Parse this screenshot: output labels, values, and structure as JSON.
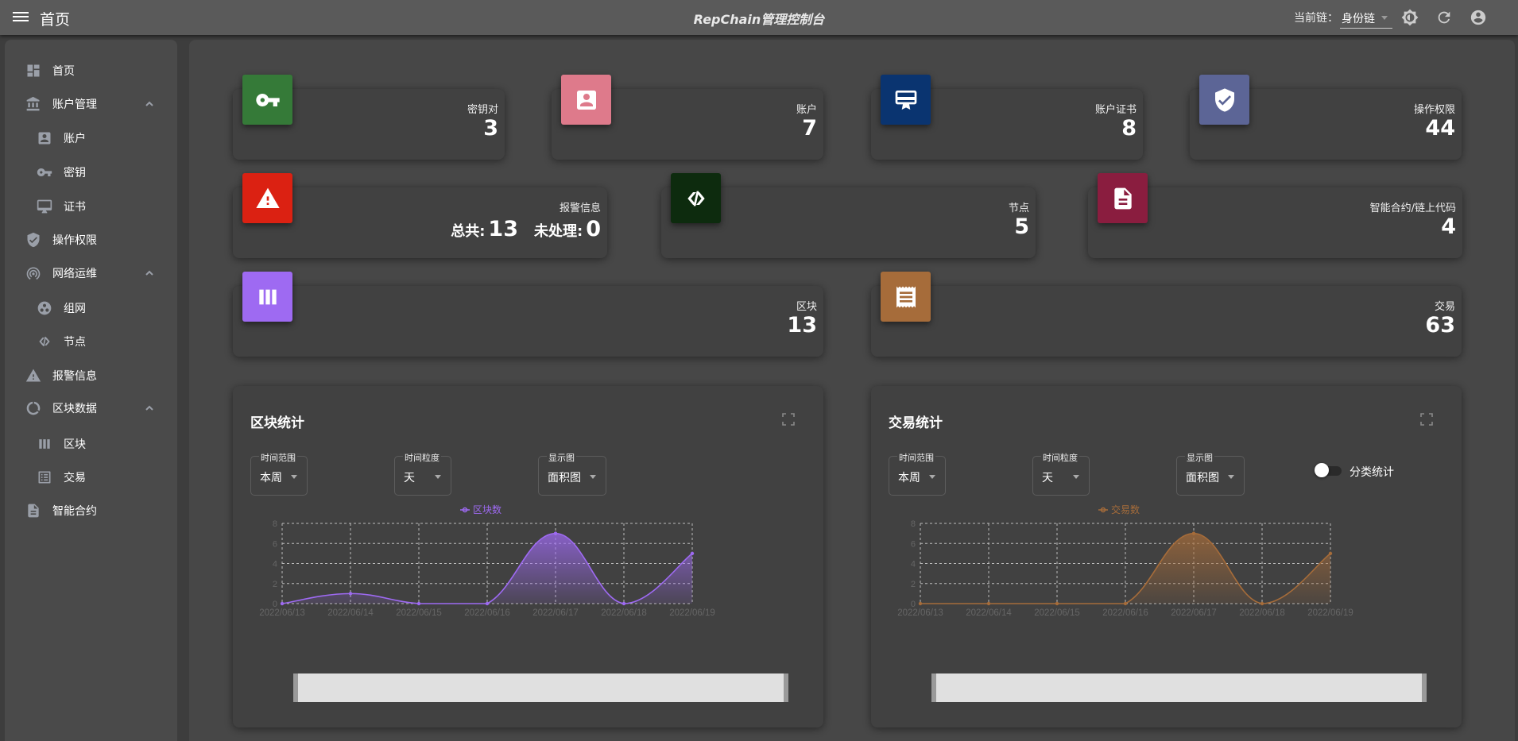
{
  "appbar": {
    "page_title": "首页",
    "app_title": "RepChain管理控制台",
    "chain_label": "当前链：",
    "chain_value": "身份链"
  },
  "sidebar": {
    "items": [
      {
        "label": "首页"
      },
      {
        "label": "账户管理"
      },
      {
        "label": "账户"
      },
      {
        "label": "密钥"
      },
      {
        "label": "证书"
      },
      {
        "label": "操作权限"
      },
      {
        "label": "网络运维"
      },
      {
        "label": "组网"
      },
      {
        "label": "节点"
      },
      {
        "label": "报警信息"
      },
      {
        "label": "区块数据"
      },
      {
        "label": "区块"
      },
      {
        "label": "交易"
      },
      {
        "label": "智能合约"
      }
    ]
  },
  "stats": {
    "keypair": {
      "label": "密钥对",
      "value": "3",
      "color": "#357a38"
    },
    "account": {
      "label": "账户",
      "value": "7",
      "color": "#de7a8b"
    },
    "cert": {
      "label": "账户证书",
      "value": "8",
      "color": "#0a3470"
    },
    "perm": {
      "label": "操作权限",
      "value": "44",
      "color": "#5c6596"
    },
    "alarm": {
      "label": "报警信息",
      "total_label": "总共:",
      "total": "13",
      "pending_label": "未处理:",
      "pending": "0",
      "color": "#db2112"
    },
    "node": {
      "label": "节点",
      "value": "5",
      "color": "#0d2b0e"
    },
    "contract": {
      "label": "智能合约/链上代码",
      "value": "4",
      "color": "#8a1d3f"
    },
    "block": {
      "label": "区块",
      "value": "13",
      "color": "#9e6af2"
    },
    "tx": {
      "label": "交易",
      "value": "63",
      "color": "#a66c3a"
    }
  },
  "block_chart": {
    "title": "区块统计",
    "range_label": "时间范围",
    "range_value": "本周",
    "gran_label": "时间粒度",
    "gran_value": "天",
    "view_label": "显示图",
    "view_value": "面积图"
  },
  "tx_chart": {
    "title": "交易统计",
    "range_label": "时间范围",
    "range_value": "本周",
    "gran_label": "时间粒度",
    "gran_value": "天",
    "view_label": "显示图",
    "view_value": "面积图",
    "toggle_label": "分类统计"
  },
  "chart_data": [
    {
      "type": "area",
      "x": [
        "2022/06/13",
        "2022/06/14",
        "2022/06/15",
        "2022/06/16",
        "2022/06/17",
        "2022/06/18",
        "2022/06/19"
      ],
      "series": [
        {
          "name": "区块数",
          "values": [
            0,
            1,
            0,
            0,
            7,
            0,
            5
          ],
          "color": "#9e6af2"
        }
      ],
      "ylim": [
        0,
        8
      ],
      "yticks": [
        0,
        2,
        4,
        6,
        8
      ],
      "legend": "top-center",
      "grid": true
    },
    {
      "type": "area",
      "x": [
        "2022/06/13",
        "2022/06/14",
        "2022/06/15",
        "2022/06/16",
        "2022/06/17",
        "2022/06/18",
        "2022/06/19"
      ],
      "series": [
        {
          "name": "交易数",
          "values": [
            0,
            0,
            0,
            0,
            7,
            0,
            5
          ],
          "color": "#a66c3a"
        }
      ],
      "ylim": [
        0,
        8
      ],
      "yticks": [
        0,
        2,
        4,
        6,
        8
      ],
      "legend": "top-center",
      "grid": true
    }
  ]
}
